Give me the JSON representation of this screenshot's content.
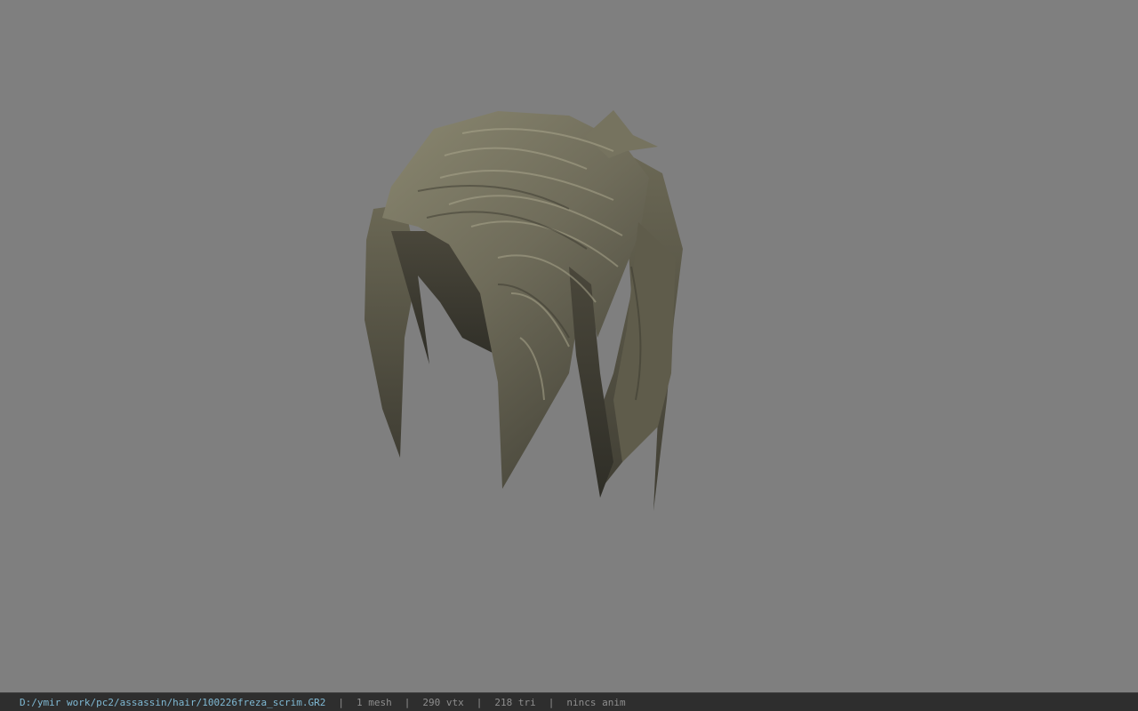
{
  "viewport": {
    "background": "#7f7f7f",
    "model": "hair mesh"
  },
  "status_bar": {
    "file_path": "D:/ymir work/pc2/assassin/hair/100226freza_scrim.GR2",
    "separator": "|",
    "mesh_count": "1 mesh",
    "vertex_count": "290 vtx",
    "triangle_count": "218 tri",
    "anim_status": "nincs anim",
    "path_color": "#7fb9d4",
    "text_color": "#8e8e8e"
  }
}
